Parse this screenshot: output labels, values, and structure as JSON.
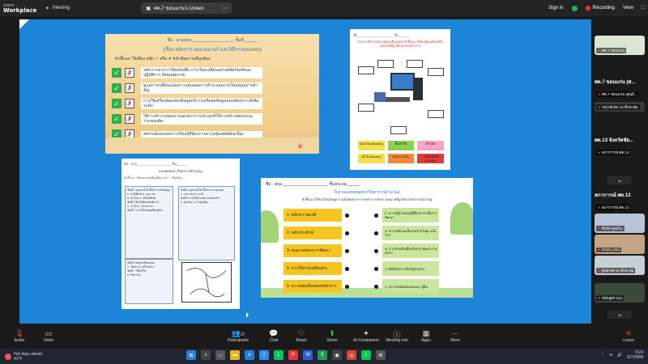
{
  "app": {
    "logo_top": "zoom",
    "logo_bottom": "Workplace"
  },
  "topbar": {
    "meeting_label": "Meeting",
    "share_label": "ศต.7 ขอนแก่น's screen",
    "signin_label": "Sign in",
    "recording_label": "Recording",
    "view_label": "View"
  },
  "worksheet1": {
    "header": "ชื่อ - นามสกุล___________________ ชั้นที่______",
    "title": "(เรื่อง หลักการ ลงงานงานร์ และวิธีการลงแหล่ง)",
    "instruction": "คำชี้แจง: ให้เลือก คลิก ✓ หรือ ✗ หน้าข้อความที่ถูกต้อง",
    "items": [
      "หลักการควรการปิดหนังสือ การเวียนเปลี่ยนอย่างผลิตภัณฑ์และปฏิบัติการ สังคมสุขภาพ",
      "ดูแลการเปลี่ยนแปลงการเสนอผลการคำนวณความใหม่อนุปการคำคัญ",
      "การใช้เครื่องพลแปลงข้อมูลบริการเสรีผสมข้อมูลแบบสังเคราะห์เพิ่มระดับ",
      "วิธีการทำงานของงานเอกสารการประยุกต์ใช้การสร้างสมรรถนะร่วมของคัด",
      "สหกรณ์ลงแหล่งการเรียนรู้ที่ต้องการความรู้ผลลัพธ์ต่อเนื่อง"
    ]
  },
  "worksheet2": {
    "header": "ชื่อ____________________ ชั้น______",
    "subtitle": "ใบงาน เรื่อง อุปกรณ์คอมพิวเตอร์ คำชี้แจง ให้นักเรียนเขียนชื่ออุปกรณ์ที่ถูกต้องลงในช่องว่าง",
    "labels": [
      {
        "text": "จอภาพ (Monitor)",
        "color": "#f4e04d"
      },
      {
        "text": "ลิ้นทกรีด",
        "color": "#8ed14f"
      },
      {
        "text": "ลำโพง",
        "color": "#f5a3c7"
      },
      {
        "text": "เม้าส์ (Mouse)",
        "color": "#f4e04d"
      },
      {
        "text": "เคส (CASE)",
        "color": "#f28a3a"
      },
      {
        "text": "เครื่องพิมพ์ (Printer)",
        "color": "#e23b3b"
      }
    ]
  },
  "worksheet3": {
    "header": "ชื่อ - สกุล___________________ ชั้น______",
    "title": "แบบทดสอบ (วิทยาการคำนวณ)",
    "instruction": "คำชี้แจง : เลือกคำตอบที่ถูกที่สุด แล้ว ✓ ที่ถูกต้อง",
    "col1": [
      "ข้อที่ 1 อุปกรณ์ใดใช้ในการรับข้อมูล",
      "ก. แป้นพิมพ์ ข. จอภาพ",
      "ค. ลำโพง ง. เครื่องพิมพ์",
      "ข้อที่ 2 ข้อใดคือซอฟต์แวร์",
      "ก. เมาส์ ข. โปรแกรม",
      "ข้อที่ 3 การเก็บข้อมูลที่ถูกต้อง"
    ],
    "col2": [
      "ข้อที่ 4 อุปกรณ์ใดใช้ในการแสดงผล",
      "ก. จอภาพ ข. เมาส์",
      "ข้อที่ 5 การใช้งานอย่างปลอดภัย",
      "ก. ถูกต้อง ข. ไม่ถูกต้อง"
    ],
    "col3": [
      "ข้อที่ 6 ปัญหาที่พบบ่อย",
      "ก. ไฟดับ ข. เครื่องค้าง",
      "ข้อที่ 7 วิธีแก้ไข",
      "ก. รีสตาร์ท"
    ]
  },
  "worksheet4": {
    "header": "ชื่อ - สกุล ____________________ ชั้นประถม______",
    "title": "ใบงานแบบทดสอบ (วิทยาการคำนวณ)",
    "instruction": "คำชี้แจง ให้นักเรียนจับคู่ความสัมพันธ์ระหว่างหลักการกับความหมายที่ถูกต้องโดยลากเส้นโยงคู่",
    "left": [
      "1. หลักความคงที่",
      "2. หลักประจักษ์",
      "3. คุณภาพของการพัฒนา",
      "4. การใช้งานเหมือนกัน",
      "5. ความต่อเนื่องของหลักการ"
    ],
    "right": [
      "ก. ความรู้ทางทฤษฎีที่ต้องการ เพื่อการพัฒนา",
      "ข. ความชัดเจนเรื่องกลไกลไม่ผูก เน้นไกล",
      "ค. การประเมินเพื่อปรับปรุง พัฒนางานต่อไป",
      "ง. ข้อดีของการเรียนรู้ร่วมกัน",
      "จ. ประโยชน์ต่อตนเองและ ผู้อื่น"
    ]
  },
  "panel": {
    "tiles": [
      {
        "name": "ศต.7 ขอนแก่น",
        "bg": "#d9e6d4"
      },
      {
        "name": "ศต.7 ขอนแก่น (ศูนย์...",
        "bg": "#1a1a1a"
      },
      {
        "name": "กญ่าณี ศต.13 ที่ประชุม",
        "bg": "#3b3b3b"
      },
      {
        "name": "สภาการณ์ ศต.13",
        "bg": "#1a1a1a"
      },
      {
        "name": "ทิพรัก ศูนย์11",
        "bg": "#b8c2d8"
      },
      {
        "name": "Chom_014",
        "bg": "#c4a484"
      },
      {
        "name": "ศูนย์ ศต.11 ที่ประชุม",
        "bg": "#c7cfd6"
      },
      {
        "name": "หลักสูตร 014",
        "bg": "#3a4a3a"
      }
    ],
    "big_labels": [
      "ศต.7 ขอนแก่น (ศ...",
      "ศต.13 จังหวัดชัย...",
      "สภาการณ์ ศต.13"
    ]
  },
  "toolbar": {
    "audio": "Audio",
    "video": "Video",
    "participants": "Participants",
    "participants_count": "37",
    "chat": "Chat",
    "react": "React",
    "share": "Share",
    "companion": "AI Companion",
    "meeting_info": "Meeting info",
    "apps": "Apps",
    "more": "More",
    "leave": "Leave"
  },
  "taskbar": {
    "weather_line1": "Hot days ahead",
    "weather_line2": "41°F",
    "time": "9:24",
    "date": "6/7/2568"
  }
}
